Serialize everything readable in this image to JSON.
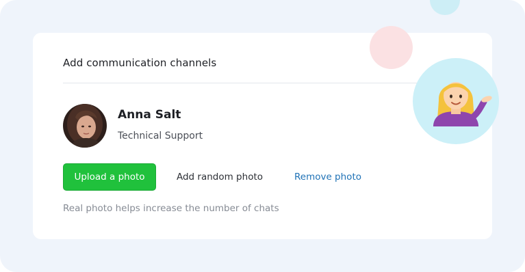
{
  "card": {
    "title": "Add communication channels"
  },
  "profile": {
    "name": "Anna Salt",
    "role": "Technical Support",
    "avatar_icon": "user-photo"
  },
  "actions": {
    "upload_label": "Upload a photo",
    "random_label": "Add random photo",
    "remove_label": "Remove photo"
  },
  "hint": "Real photo helps increase the number of chats",
  "decoration": {
    "emoji_icon": "woman-tipping-hand-emoji"
  },
  "colors": {
    "accent_green": "#20c13c",
    "link_blue": "#1f72b6",
    "backdrop": "#eff4fb",
    "bubble_cyan": "#ccf0f8",
    "bubble_pink": "#fbe1e3"
  }
}
